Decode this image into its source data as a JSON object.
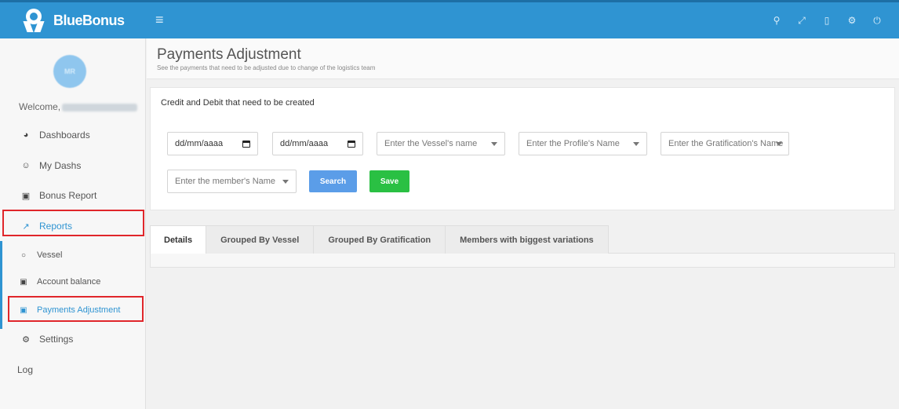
{
  "app": {
    "brand": "BlueBonus",
    "menu_glyph": "≡"
  },
  "topbar": {
    "icons": [
      {
        "name": "search-icon",
        "glyph": "⚲"
      },
      {
        "name": "expand-icon",
        "glyph": "⤢"
      },
      {
        "name": "mobile-icon",
        "glyph": "▯"
      },
      {
        "name": "gears-icon",
        "glyph": "⚙"
      },
      {
        "name": "power-icon",
        "glyph": "⏻"
      }
    ]
  },
  "sidebar": {
    "avatar_initials": "MR",
    "welcome": "Welcome,",
    "items": {
      "dashboards": {
        "label": "Dashboards",
        "glyph": "◕"
      },
      "my_dashs": {
        "label": "My Dashs",
        "glyph": "☺"
      },
      "bonus_report": {
        "label": "Bonus Report",
        "glyph": "▣"
      },
      "reports": {
        "label": "Reports",
        "glyph": "↗"
      },
      "vessel": {
        "label": "Vessel",
        "glyph": "○"
      },
      "account_balance": {
        "label": "Account balance",
        "glyph": "▣"
      },
      "payments_adjustment": {
        "label": "Payments Adjustment",
        "glyph": "▣"
      },
      "settings": {
        "label": "Settings",
        "glyph": "⚙"
      },
      "log": {
        "label": "Log"
      }
    }
  },
  "header": {
    "title": "Payments Adjustment",
    "subtitle": "See the payments that need to be adjusted due to change of the logistics team"
  },
  "filters": {
    "card_title": "Credit and Debit that need to be created",
    "date_from": "dd/mm/aaaa",
    "date_to": "dd/mm/aaaa",
    "vessel_placeholder": "Enter the Vessel's name",
    "profile_placeholder": "Enter the Profile's Name",
    "gratification_placeholder": "Enter the Gratification's Name",
    "member_placeholder": "Enter the member's Name",
    "search_label": "Search",
    "save_label": "Save"
  },
  "tabs": [
    {
      "label": "Details",
      "active": true
    },
    {
      "label": "Grouped By Vessel",
      "active": false
    },
    {
      "label": "Grouped By Gratification",
      "active": false
    },
    {
      "label": "Members with biggest variations",
      "active": false
    }
  ],
  "colors": {
    "primary": "#2f94d2",
    "search": "#5b9de8",
    "save": "#2ac043",
    "highlight": "#e0262b"
  }
}
